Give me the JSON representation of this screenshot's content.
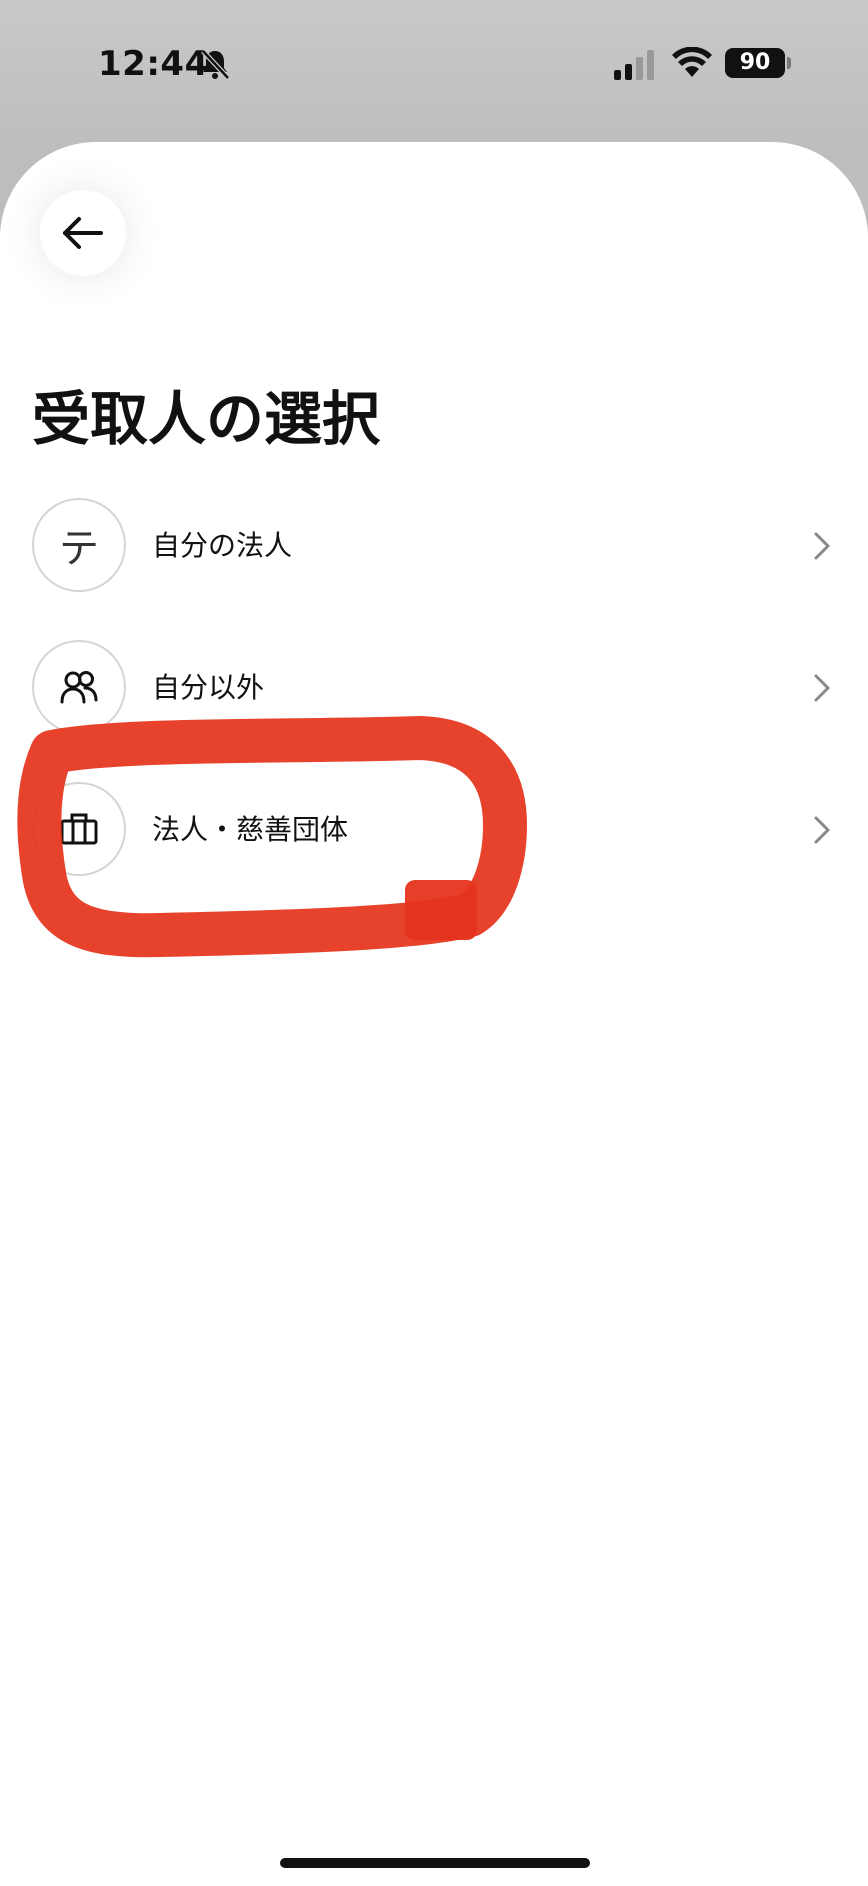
{
  "status_bar": {
    "time": "12:44",
    "battery": "90",
    "icons": [
      "bell-slash-icon",
      "signal-icon",
      "wifi-icon",
      "battery-icon"
    ]
  },
  "header": {
    "back_icon": "arrow-left-icon",
    "title": "受取人の選択"
  },
  "recipients": [
    {
      "label": "自分の法人",
      "avatar_text": "テ",
      "icon": "letter-avatar"
    },
    {
      "label": "自分以外",
      "icon": "people-icon"
    },
    {
      "label": "法人・慈善団体",
      "icon": "briefcase-icon"
    }
  ],
  "annotation": {
    "color": "#e5341c",
    "description": "hand-drawn highlight circle"
  },
  "colors": {
    "background_top": "#c9c9c9",
    "sheet": "#ffffff",
    "text": "#111111",
    "chevron": "#888888"
  }
}
